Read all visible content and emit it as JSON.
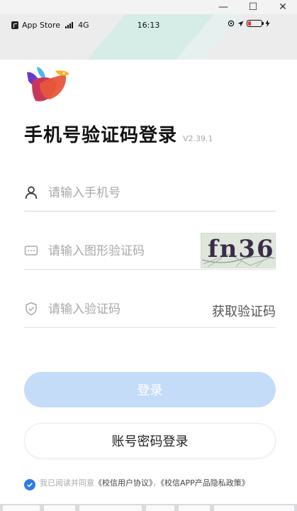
{
  "window": {
    "minimize_glyph": "—",
    "maximize_glyph": "☐",
    "close_glyph": "✕"
  },
  "status_bar": {
    "back_app": "App Store",
    "network": "4G",
    "time": "16:13"
  },
  "login": {
    "title": "手机号验证码登录",
    "version": "V2.39.1",
    "phone_placeholder": "请输入手机号",
    "captcha_placeholder": "请输入图形验证码",
    "captcha_text": "fn36",
    "code_placeholder": "请输入验证码",
    "get_code_label": "获取验证码",
    "login_button": "登录",
    "password_login_button": "账号密码登录"
  },
  "agreement": {
    "prefix": "我已阅读并同意",
    "user_agreement": "《校信用户协议》",
    "separator": "，",
    "privacy_policy": "《校信APP产品隐私政策》",
    "checked": true
  },
  "colors": {
    "primary_blue": "#2f7be5",
    "login_button_disabled": "#c5dcf8",
    "placeholder_gray": "#a8a8a8"
  },
  "icons": [
    "user-icon",
    "captcha-icon",
    "shield-icon",
    "bird-logo",
    "check-icon"
  ]
}
